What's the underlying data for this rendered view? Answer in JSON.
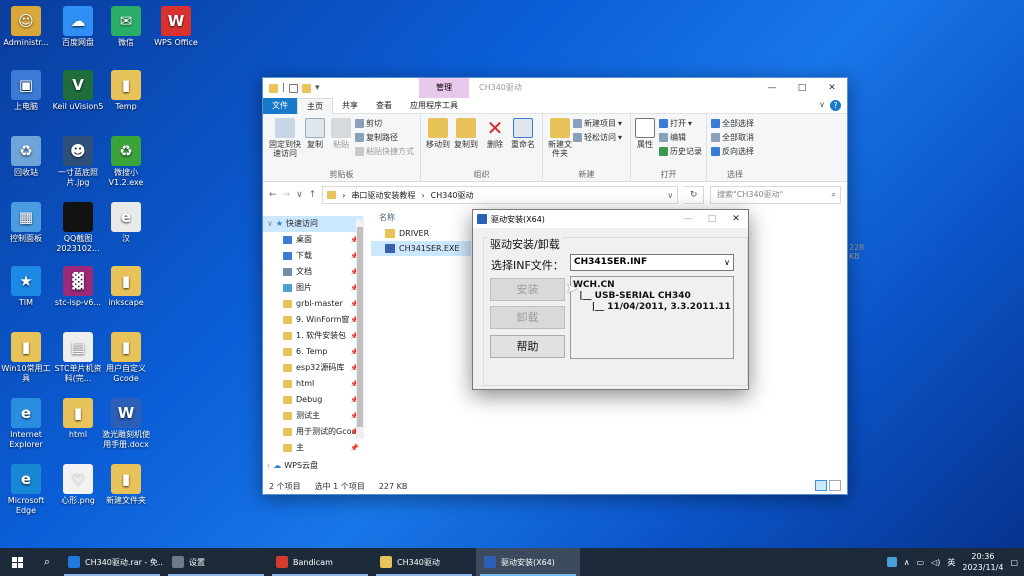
{
  "desktop": {
    "icons": [
      {
        "label": "Administr...",
        "color": "#d9a83b",
        "glyph": "☺"
      },
      {
        "label": "百度网盘",
        "color": "#2f8ff5",
        "glyph": "☁"
      },
      {
        "label": "微信",
        "color": "#2aae67",
        "glyph": "✉"
      },
      {
        "label": "WPS Office",
        "color": "#d9322e",
        "glyph": "W"
      },
      {
        "label": "上电脑",
        "color": "#3b7bd6",
        "glyph": "▣"
      },
      {
        "label": "Keil uVision5",
        "color": "#1f6d3a",
        "glyph": "V"
      },
      {
        "label": "Temp",
        "color": "#e8c35a",
        "glyph": "▮"
      },
      {
        "label": "回收站",
        "color": "#6fa4d8",
        "glyph": "♻"
      },
      {
        "label": "一寸蓝底照片.jpg",
        "color": "#2d4f7a",
        "glyph": "☻"
      },
      {
        "label": "微搜小 V1.2.exe",
        "color": "#3aa33a",
        "glyph": "♻"
      },
      {
        "label": "控制面板",
        "color": "#4a9be0",
        "glyph": "▦"
      },
      {
        "label": "QQ截图 2023102...",
        "color": "#111111",
        "glyph": ""
      },
      {
        "label": "汉",
        "color": "#eaeaea",
        "glyph": "e"
      },
      {
        "label": "TIM",
        "color": "#1e88e5",
        "glyph": "★"
      },
      {
        "label": "stc-isp-v6...",
        "color": "#9b2a78",
        "glyph": "▓"
      },
      {
        "label": "inkscape",
        "color": "#e8c35a",
        "glyph": "▮"
      },
      {
        "label": "Win10常用工具",
        "color": "#e8c35a",
        "glyph": "▮"
      },
      {
        "label": "STC单片机资料(完...",
        "color": "#eeeeee",
        "glyph": "▤"
      },
      {
        "label": "用户自定义Gcode",
        "color": "#e8c35a",
        "glyph": "▮"
      },
      {
        "label": "Internet Explorer",
        "color": "#2a8ee0",
        "glyph": "e"
      },
      {
        "label": "html",
        "color": "#e8c35a",
        "glyph": "▮"
      },
      {
        "label": "激光雕刻机使用手册.docx",
        "color": "#2b5fb8",
        "glyph": "W"
      },
      {
        "label": "Microsoft Edge",
        "color": "#1787d6",
        "glyph": "e"
      },
      {
        "label": "心形.png",
        "color": "#f2f2f2",
        "glyph": "♡"
      },
      {
        "label": "新建文件夹",
        "color": "#e8c35a",
        "glyph": "▮"
      }
    ]
  },
  "explorer": {
    "context_tab": "管理",
    "title": "CH340驱动",
    "controls": {
      "minimize": "—",
      "maximize": "□",
      "close": "✕"
    },
    "tabs": [
      "文件",
      "主页",
      "共享",
      "查看",
      "应用程序工具"
    ],
    "help": "?",
    "ribbon": {
      "clipboard": {
        "name": "剪贴板",
        "pin": "固定到快速访问",
        "copy": "复制",
        "paste": "粘贴",
        "cut": "剪切",
        "copy_path": "复制路径",
        "paste_shortcut": "粘贴快捷方式"
      },
      "organize": {
        "name": "组织",
        "move_to": "移动到",
        "copy_to": "复制到",
        "delete": "删除",
        "rename": "重命名"
      },
      "new": {
        "name": "新建",
        "new_folder": "新建文件夹",
        "new_item": "新建项目",
        "easy_access": "轻松访问"
      },
      "open": {
        "name": "打开",
        "properties": "属性",
        "open": "打开",
        "edit": "编辑",
        "history": "历史记录"
      },
      "select": {
        "name": "选择",
        "select_all": "全部选择",
        "select_none": "全部取消",
        "invert": "反向选择"
      }
    },
    "breadcrumb": [
      "串口驱动安装教程",
      "CH340驱动"
    ],
    "search_placeholder": "搜索\"CH340驱动\"",
    "nav": {
      "quick_access": "快速访问",
      "items": [
        {
          "label": "桌面",
          "color": "#3a7bd5"
        },
        {
          "label": "下载",
          "color": "#3a7bd5"
        },
        {
          "label": "文档",
          "color": "#7a8aa0"
        },
        {
          "label": "图片",
          "color": "#4aa0d8"
        },
        {
          "label": "grbl-master",
          "color": "#e8c35a"
        },
        {
          "label": "9. WinForm窗",
          "color": "#e8c35a"
        },
        {
          "label": "1. 软件安装包",
          "color": "#e8c35a"
        },
        {
          "label": "6. Temp",
          "color": "#e8c35a"
        },
        {
          "label": "esp32源码库",
          "color": "#e8c35a"
        },
        {
          "label": "html",
          "color": "#e8c35a"
        },
        {
          "label": "Debug",
          "color": "#e8c35a"
        },
        {
          "label": "测试主",
          "color": "#e8c35a"
        },
        {
          "label": "用于测试的Gcod",
          "color": "#e8c35a"
        },
        {
          "label": "主",
          "color": "#e8c35a"
        }
      ],
      "wps": "WPS云盘"
    },
    "column_header": "名称",
    "files": [
      {
        "name": "DRIVER",
        "color": "#e8c35a"
      },
      {
        "name": "CH341SER.EXE",
        "color": "#3b5fb0"
      }
    ],
    "exe_size": "228 KB",
    "status": {
      "count": "2 个项目",
      "selected": "选中 1 个项目",
      "size": "227 KB"
    }
  },
  "dialog": {
    "title": "驱动安装(X64)",
    "group": "驱动安装/卸载",
    "inf_label": "选择INF文件：",
    "inf_value": "CH341SER.INF",
    "buttons": {
      "install": "安装",
      "uninstall": "卸载",
      "help": "帮助"
    },
    "tree_text": "WCH.CN\n  |__ USB-SERIAL CH340\n      |__ 11/04/2011, 3.3.2011.11"
  },
  "taskbar": {
    "items": [
      {
        "label": "CH340驱动.rar - 免...",
        "color": "#1f7ae0"
      },
      {
        "label": "设置",
        "color": "#6f7a86"
      },
      {
        "label": "Bandicam",
        "color": "#d63a2f"
      },
      {
        "label": "CH340驱动",
        "color": "#e8c35a"
      },
      {
        "label": "驱动安装(X64)",
        "color": "#2b5fb8"
      }
    ],
    "ime": "英",
    "time": "20:36",
    "date": "2023/11/4"
  }
}
